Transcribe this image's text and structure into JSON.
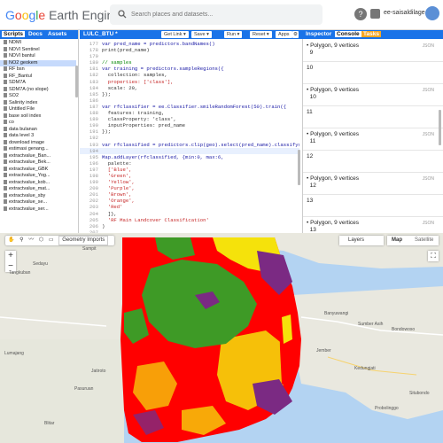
{
  "app": {
    "logo_google": "Google",
    "logo_rest": " Earth Engine",
    "search_placeholder": "Search places and datasets...",
    "help_label": "?",
    "user_name": "ee-saisaldilage"
  },
  "left_panel": {
    "tabs": [
      "Scripts",
      "Docs",
      "Assets"
    ],
    "files": [
      "NDMI",
      "NDVI Sentinel",
      "NDVI bantul",
      "NO2 geokem",
      "RF bsn",
      "RF_Bantul",
      "SDM7A",
      "SDM7A (no slope)",
      "SO2",
      "Salinity index",
      "Untitled File",
      "base soil index",
      "co",
      "data bulanan",
      "data level 3",
      "download image",
      "estimasi genang...",
      "extractvalue_Ban...",
      "extractvalue_Bek...",
      "extractvalue_GBK",
      "extractvalue_Yog...",
      "extractvalue_kob...",
      "extractvalue_mat...",
      "extractvalue_sby",
      "extractvalue_se...",
      "extractvalue_ser..."
    ],
    "selected_index": 3
  },
  "editor": {
    "title": "LULC_BTU *",
    "buttons": {
      "get_link": "Get Link ▾",
      "save": "Save ▾",
      "run": "Run ▾",
      "reset": "Reset ▾",
      "apps": "Apps",
      "settings": "⚙"
    },
    "highlighted_line": 194,
    "lines": [
      {
        "n": "177",
        "t": "var pred_name = predictors.bandNames()"
      },
      {
        "n": "178",
        "t": "print(pred_name)"
      },
      {
        "n": "179",
        "t": ""
      },
      {
        "n": "180",
        "t": "// samples"
      },
      {
        "n": "181",
        "t": "var training = predictors.sampleRegions({"
      },
      {
        "n": "182",
        "t": "  collection: samples,"
      },
      {
        "n": "183",
        "t": "  properties: ['class'],"
      },
      {
        "n": "184",
        "t": "  scale: 20,"
      },
      {
        "n": "185",
        "t": "});"
      },
      {
        "n": "186",
        "t": ""
      },
      {
        "n": "187",
        "t": "var rfclassifier = ee.Classifier.smileRandomForest(50).train({"
      },
      {
        "n": "188",
        "t": "  features: training,"
      },
      {
        "n": "189",
        "t": "  classProperty: 'class',"
      },
      {
        "n": "190",
        "t": "  inputProperties: pred_name"
      },
      {
        "n": "191",
        "t": "});"
      },
      {
        "n": "192",
        "t": ""
      },
      {
        "n": "193",
        "t": "var rfclassified = predictors.clip(geo).select(pred_name).classify(rfclassifier)"
      },
      {
        "n": "194",
        "t": ""
      },
      {
        "n": "195",
        "t": "Map.addLayer(rfclassified, {min:0, max:6,"
      },
      {
        "n": "196",
        "t": "  palette:"
      },
      {
        "n": "197",
        "t": "  ['Blue',"
      },
      {
        "n": "198",
        "t": "  'Green',"
      },
      {
        "n": "199",
        "t": "  'Yellow',"
      },
      {
        "n": "200",
        "t": "  'Purple',"
      },
      {
        "n": "201",
        "t": "  'Brown',"
      },
      {
        "n": "202",
        "t": "  'Orange',"
      },
      {
        "n": "203",
        "t": "  'Red'"
      },
      {
        "n": "204",
        "t": "  ]},"
      },
      {
        "n": "205",
        "t": "  'RF Main Landcover Classification'"
      },
      {
        "n": "206",
        "t": ")"
      },
      {
        "n": "207",
        "t": ""
      }
    ]
  },
  "right_panel": {
    "tabs": [
      "Inspector",
      "Console",
      "Tasks"
    ],
    "json_label": "JSON",
    "entries": [
      {
        "poly": "• Polygon, 9 vertices",
        "id": "9"
      },
      {
        "poly": "",
        "id": "10"
      },
      {
        "poly": "• Polygon, 9 vertices",
        "id": "10"
      },
      {
        "poly": "",
        "id": "11"
      },
      {
        "poly": "• Polygon, 9 vertices",
        "id": "11"
      },
      {
        "poly": "",
        "id": "12"
      },
      {
        "poly": "• Polygon, 9 vertices",
        "id": "12"
      },
      {
        "poly": "",
        "id": "13"
      },
      {
        "poly": "• Polygon, 9 vertices",
        "id": "13"
      }
    ]
  },
  "map": {
    "geometry_imports": "Geometry Imports",
    "layers_label": "Layers",
    "map_label": "Map",
    "satellite_label": "Satellite",
    "places": [
      "Sedayu",
      "Sampit",
      "Tangkuban",
      "Banyuwangi",
      "Sumber Asih",
      "Bondowoso",
      "Kedungjati",
      "Jember",
      "Situbondo",
      "Probolinggo",
      "Jatiroto",
      "Lumajang",
      "Blitar",
      "Pasuruan"
    ],
    "palette": {
      "blue": "#1f4fb4",
      "green": "#3e9a26",
      "yellow": "#f5e20b",
      "purple": "#7b2a83",
      "red": "#ff0000",
      "water": "#b3d3f2",
      "land": "#e8e8e0"
    }
  }
}
